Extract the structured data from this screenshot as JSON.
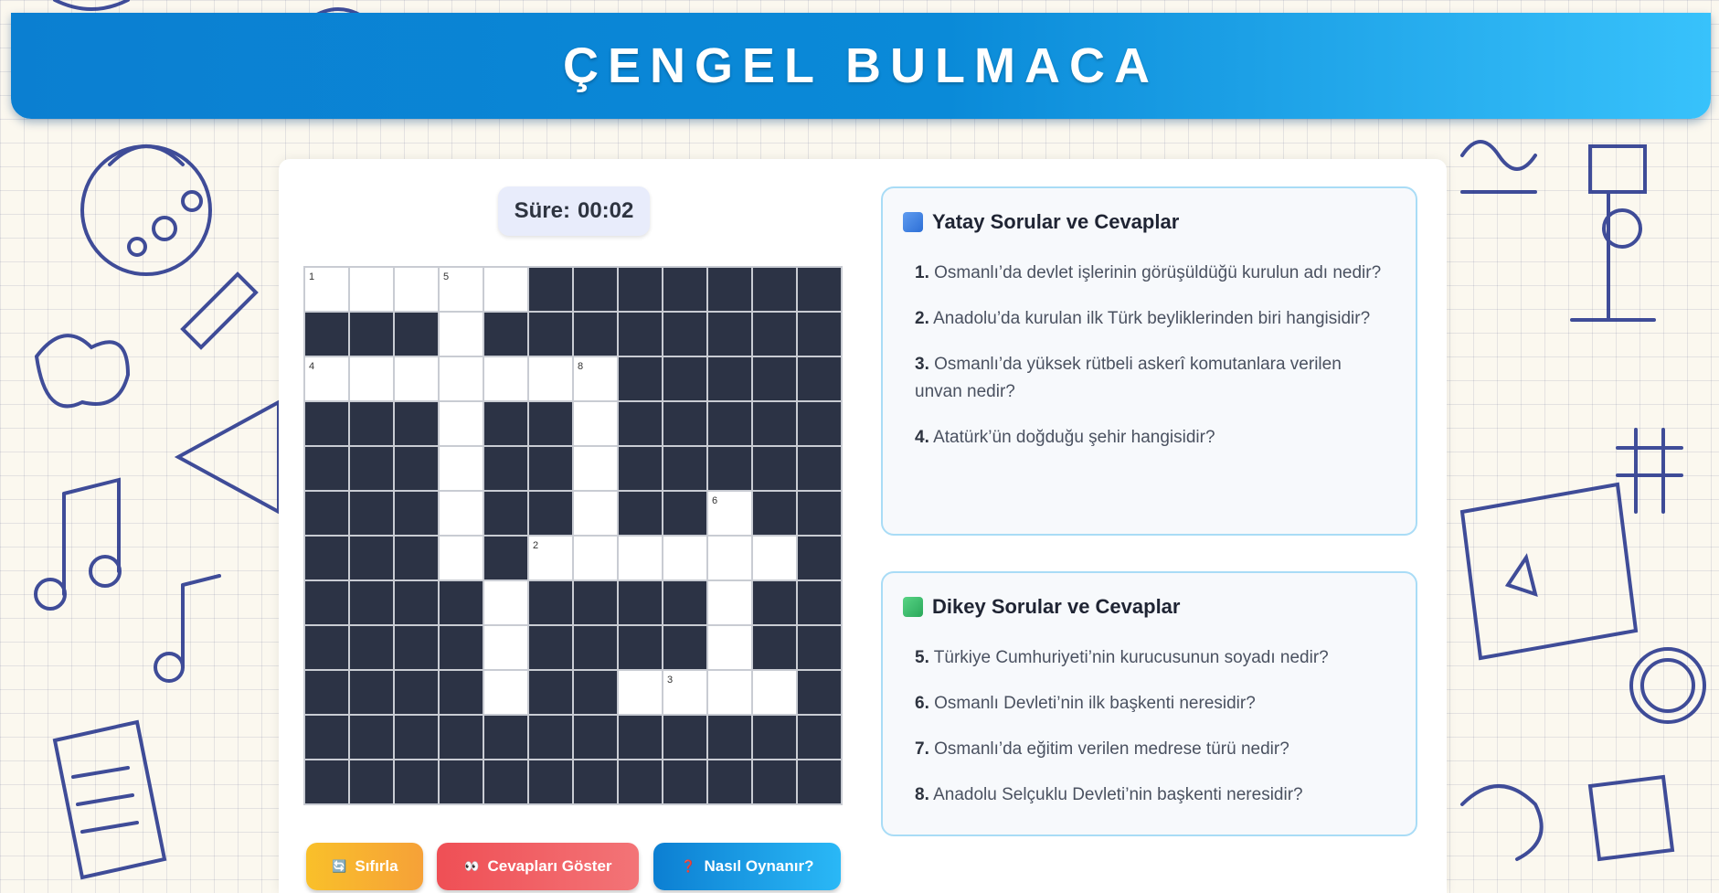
{
  "header": {
    "title": "ÇENGEL BULMACA"
  },
  "timer": {
    "label": "Süre:",
    "value": "00:02"
  },
  "grid": {
    "rows": [
      "11111.......",
      "...1........",
      "1111111.....",
      "...1..1.....",
      "...1..1.....",
      "...1..1..1..",
      "...1.111111.",
      "....1....1..",
      "....1....1..",
      "....1..1111.",
      "............",
      "............"
    ],
    "numbers": [
      {
        "row": 0,
        "col": 0,
        "n": "1"
      },
      {
        "row": 0,
        "col": 3,
        "n": "5"
      },
      {
        "row": 2,
        "col": 0,
        "n": "4"
      },
      {
        "row": 2,
        "col": 6,
        "n": "8"
      },
      {
        "row": 5,
        "col": 9,
        "n": "6"
      },
      {
        "row": 6,
        "col": 5,
        "n": "2"
      },
      {
        "row": 9,
        "col": 8,
        "n": "3"
      }
    ]
  },
  "buttons": {
    "reset": {
      "icon": "🔄",
      "label": "Sıfırla"
    },
    "show": {
      "icon": "👀",
      "label": "Cevapları Göster"
    },
    "help": {
      "icon": "❓",
      "label": "Nasıl Oynanır?"
    }
  },
  "across": {
    "title": "Yatay Sorular ve Cevaplar",
    "icon": "blue-square-icon",
    "clues": [
      {
        "num": "1.",
        "text": "Osmanlı’da devlet işlerinin görüşüldüğü kurulun adı nedir?"
      },
      {
        "num": "2.",
        "text": "Anadolu’da kurulan ilk Türk beyliklerinden biri hangisidir?"
      },
      {
        "num": "3.",
        "text": "Osmanlı’da yüksek rütbeli askerî komutanlara verilen unvan nedir?"
      },
      {
        "num": "4.",
        "text": "Atatürk’ün doğduğu şehir hangisidir?"
      }
    ]
  },
  "down": {
    "title": "Dikey Sorular ve Cevaplar",
    "icon": "green-square-icon",
    "clues": [
      {
        "num": "5.",
        "text": "Türkiye Cumhuriyeti’nin kurucusunun soyadı nedir?"
      },
      {
        "num": "6.",
        "text": "Osmanlı Devleti’nin ilk başkenti neresidir?"
      },
      {
        "num": "7.",
        "text": "Osmanlı’da eğitim verilen medrese türü nedir?"
      },
      {
        "num": "8.",
        "text": "Anadolu Selçuklu Devleti’nin başkenti neresidir?"
      }
    ]
  },
  "colors": {
    "header_start": "#0b7fd1",
    "header_end": "#38c2fb",
    "block": "#2c3345",
    "reset": "#f9c02a",
    "show": "#ef4f55",
    "help": "#0c7fd2"
  }
}
